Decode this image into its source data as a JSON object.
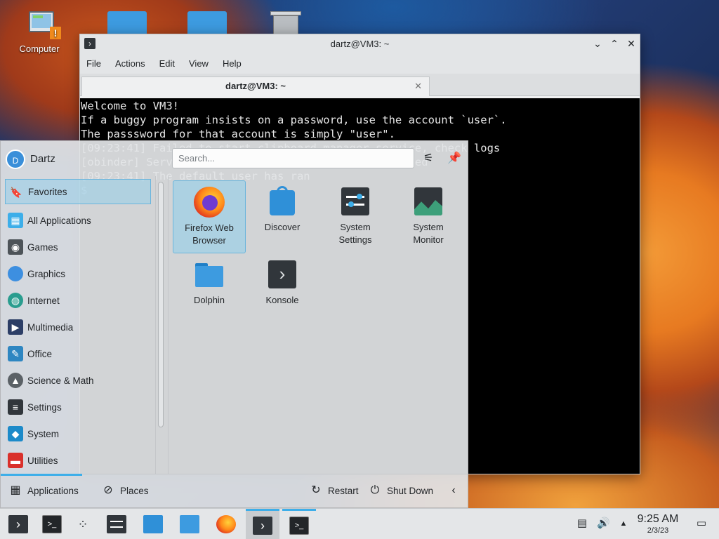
{
  "desktop": {
    "computer_label": "Computer"
  },
  "terminal": {
    "title": "dartz@VM3: ~",
    "menu": [
      "File",
      "Actions",
      "Edit",
      "View",
      "Help"
    ],
    "tab_title": "dartz@VM3: ~",
    "lines": [
      "Welcome to VM3!",
      "If a buggy program insists on a password, use the account `user`.",
      "The passsword for that account is simply \"user\".",
      "",
      "",
      "[09:23:41] Failed to start clipboard manager service, check logs",
      "[obinder] Service manager / zanbok shader had started",
      "[09:23:41] The default user has ran",
      "$"
    ]
  },
  "launcher": {
    "user_name": "Dartz",
    "avatar_letter": "D",
    "search_placeholder": "Search...",
    "categories": [
      {
        "label": "Favorites",
        "icon": "bookmark-icon"
      },
      {
        "label": "All Applications",
        "icon": "grid-icon"
      },
      {
        "label": "Games",
        "icon": "gamepad-icon"
      },
      {
        "label": "Graphics",
        "icon": "graphics-icon"
      },
      {
        "label": "Internet",
        "icon": "globe-icon"
      },
      {
        "label": "Multimedia",
        "icon": "multimedia-icon"
      },
      {
        "label": "Office",
        "icon": "office-icon"
      },
      {
        "label": "Science & Math",
        "icon": "science-icon"
      },
      {
        "label": "Settings",
        "icon": "settings-icon"
      },
      {
        "label": "System",
        "icon": "system-icon"
      },
      {
        "label": "Utilities",
        "icon": "utilities-icon"
      }
    ],
    "apps": [
      {
        "label1": "Firefox Web",
        "label2": "Browser"
      },
      {
        "label1": "Discover",
        "label2": ""
      },
      {
        "label1": "System",
        "label2": "Settings"
      },
      {
        "label1": "System",
        "label2": "Monitor"
      },
      {
        "label1": "Dolphin",
        "label2": ""
      },
      {
        "label1": "Konsole",
        "label2": ""
      }
    ],
    "footer": {
      "applications": "Applications",
      "places": "Places",
      "restart": "Restart",
      "shutdown": "Shut Down"
    }
  },
  "taskbar": {
    "time": "9:25 AM",
    "date": "2/3/23"
  },
  "colors": {
    "accent": "#3daee9",
    "selection": "#93cee9",
    "terminal_bg": "#000000"
  }
}
